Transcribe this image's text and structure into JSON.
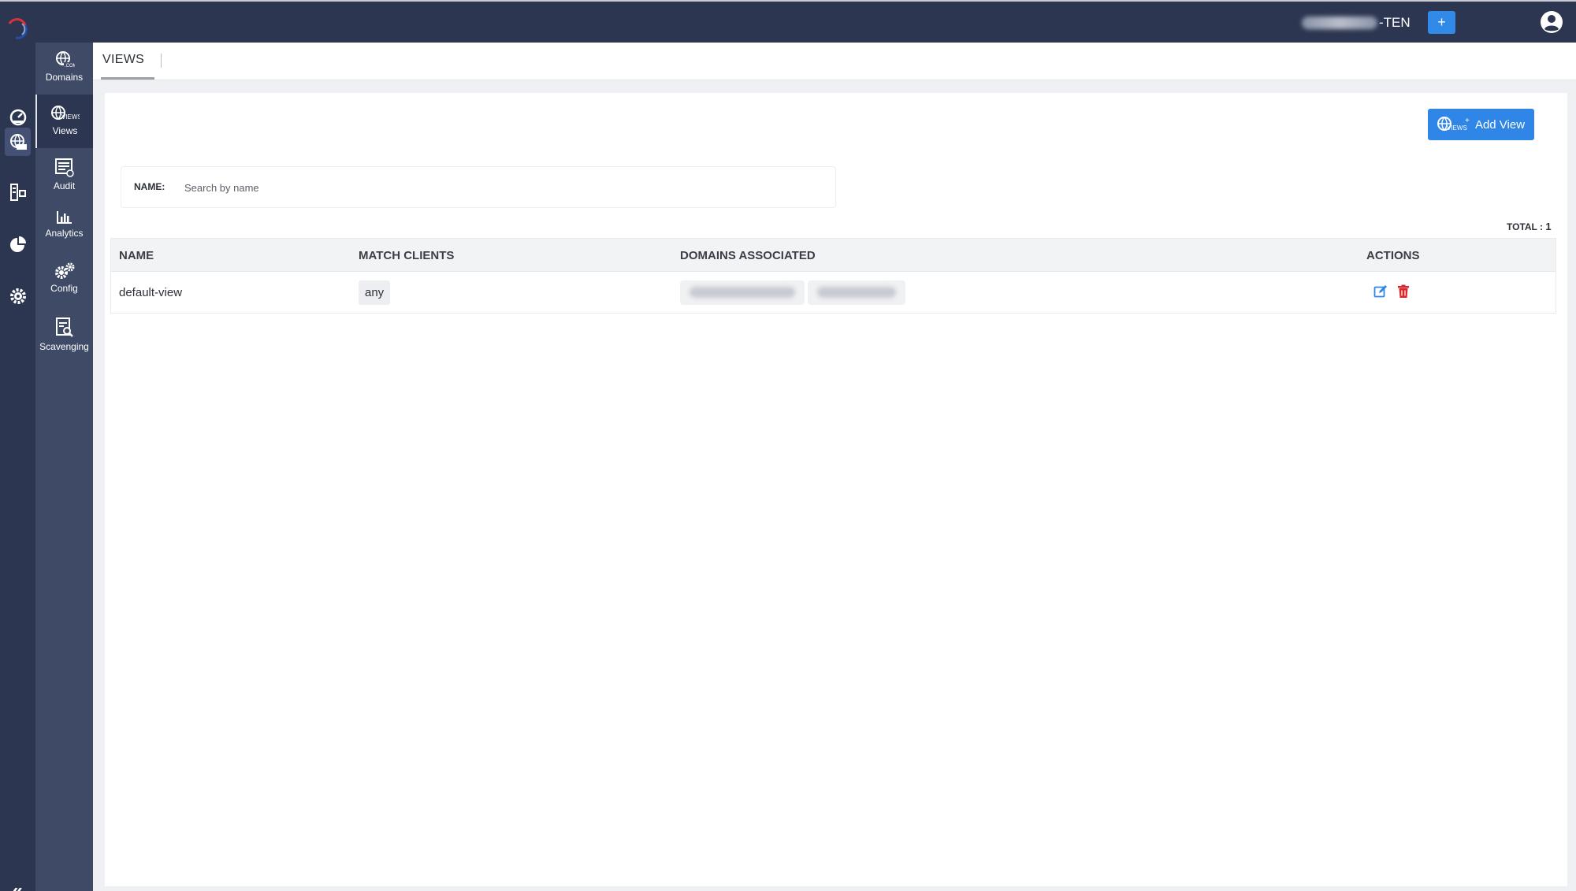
{
  "topbar": {
    "tenant_suffix": "-TEN",
    "add_button_label": "+"
  },
  "sidebar": {
    "items": [
      {
        "label": "Domains",
        "icon": "globe-com-icon"
      },
      {
        "label": "Views",
        "icon": "globe-views-icon"
      },
      {
        "label": "Audit",
        "icon": "audit-icon"
      },
      {
        "label": "Analytics",
        "icon": "bar-chart-icon"
      },
      {
        "label": "Config",
        "icon": "gears-icon"
      },
      {
        "label": "Scavenging",
        "icon": "document-search-icon"
      }
    ],
    "active": "Views"
  },
  "rail": {
    "icons": [
      "dashboard-icon",
      "dns-globe-icon",
      "ipam-icon",
      "pie-chart-icon",
      "settings-gear-icon"
    ],
    "collapse_label": "«"
  },
  "tabs": [
    {
      "label": "VIEWS"
    }
  ],
  "toolbar": {
    "add_view_label": "Add View"
  },
  "filter": {
    "name_label": "NAME:",
    "placeholder": "Search by name"
  },
  "summary": {
    "total_label": "TOTAL :",
    "total_value": "1"
  },
  "table": {
    "columns": [
      "NAME",
      "MATCH CLIENTS",
      "DOMAINS ASSOCIATED",
      "ACTIONS"
    ],
    "rows": [
      {
        "name": "default-view",
        "match_clients": "any"
      }
    ]
  },
  "colors": {
    "topbar_bg": "#2d3651",
    "sidebar_bg": "#3f4a66",
    "primary": "#2f86e6",
    "edit": "#2f86e6",
    "delete": "#d9262c"
  }
}
